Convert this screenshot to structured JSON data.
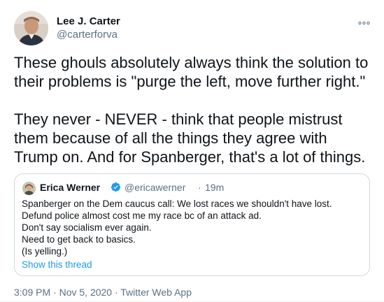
{
  "author": {
    "name": "Lee J. Carter",
    "handle": "@carterforva",
    "avatar_icon": "profile-photo"
  },
  "more_icon": "more-options-icon",
  "tweet": {
    "paragraphs": [
      "These ghouls absolutely always think the solution to their problems is \"purge the left, move further right.\"",
      "They never - NEVER - think that people mistrust them because of all the things they agree with Trump on. And for Spanberger, that's a lot of things."
    ]
  },
  "quoted": {
    "name": "Erica Werner",
    "verified_icon": "verified-badge-icon",
    "handle": "@ericawerner",
    "separator": "·",
    "time": "19m",
    "lines": [
      "Spanberger on the Dem caucus call: We lost races we shouldn't have lost.",
      "Defund police almost cost me my race bc of an attack ad.",
      "Don't say socialism ever again.",
      "Need to get back to basics.",
      "(Is yelling.)"
    ],
    "show_thread": "Show this thread"
  },
  "meta": {
    "time": "3:09 PM",
    "separator": "·",
    "date": "Nov 5, 2020",
    "source": "Twitter Web App"
  },
  "colors": {
    "text": "#0f1419",
    "secondary": "#5b7083",
    "link": "#1d9bf0",
    "border": "#cfd9de"
  }
}
